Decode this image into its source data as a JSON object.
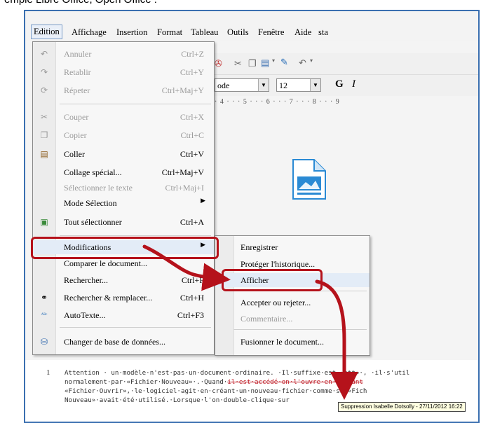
{
  "caption": "emple Libre Office, Open Office :",
  "menubar": {
    "items": [
      "Edition",
      "Affichage",
      "Insertion",
      "Format",
      "Tableau",
      "Outils",
      "Fenêtre",
      "Aide",
      "sta"
    ]
  },
  "toolbar": {
    "style_value": "ode",
    "size_value": "12",
    "bold": "G",
    "italic": "I"
  },
  "ruler": "· 4 · · · 5 · · · 6 · · · 7 · · · 8 · · · 9",
  "edit_menu": {
    "items": [
      {
        "label": "Annuler",
        "shortcut": "Ctrl+Z",
        "disabled": true,
        "icon": "undo-icon"
      },
      {
        "label": "Retablir",
        "shortcut": "Ctrl+Y",
        "disabled": true,
        "icon": "redo-icon"
      },
      {
        "label": "Répeter",
        "shortcut": "Ctrl+Maj+Y",
        "disabled": true,
        "icon": "repeat-icon"
      },
      {
        "label": "Couper",
        "shortcut": "Ctrl+X",
        "disabled": true,
        "icon": "cut-icon"
      },
      {
        "label": "Copier",
        "shortcut": "Ctrl+C",
        "disabled": true,
        "icon": "copy-icon"
      },
      {
        "label": "Coller",
        "shortcut": "Ctrl+V",
        "disabled": false,
        "icon": "paste-icon"
      },
      {
        "label": "Collage spécial...",
        "shortcut": "Ctrl+Maj+V",
        "disabled": false,
        "icon": ""
      },
      {
        "label": "Sélectionner le texte",
        "shortcut": "Ctrl+Maj+I",
        "disabled": true,
        "icon": ""
      },
      {
        "label": "Mode Sélection",
        "shortcut": "",
        "disabled": false,
        "icon": ""
      },
      {
        "label": "Tout sélectionner",
        "shortcut": "Ctrl+A",
        "disabled": false,
        "icon": "select-all-icon"
      },
      {
        "label": "Modifications",
        "shortcut": "",
        "disabled": false,
        "icon": ""
      },
      {
        "label": "Comparer le document...",
        "shortcut": "",
        "disabled": false,
        "icon": ""
      },
      {
        "label": "Rechercher...",
        "shortcut": "Ctrl+F",
        "disabled": false,
        "icon": ""
      },
      {
        "label": "Rechercher & remplacer...",
        "shortcut": "Ctrl+H",
        "disabled": false,
        "icon": "binoculars-icon"
      },
      {
        "label": "AutoTexte...",
        "shortcut": "Ctrl+F3",
        "disabled": false,
        "icon": "autotext-icon"
      },
      {
        "label": "Changer de base de données...",
        "shortcut": "",
        "disabled": false,
        "icon": "database-icon"
      }
    ]
  },
  "submenu": {
    "items": [
      {
        "label": "Enregistrer",
        "disabled": false
      },
      {
        "label": "Protéger l'historique...",
        "disabled": false
      },
      {
        "label": "Afficher",
        "disabled": false,
        "checked": true
      },
      {
        "label": "Accepter ou rejeter...",
        "disabled": false
      },
      {
        "label": "Commentaire...",
        "disabled": true
      },
      {
        "label": "Fusionner le document...",
        "disabled": false
      }
    ]
  },
  "document": {
    "line_number": "1",
    "line1_a": "Attention · un·modèle·n'est·pas·un·document·ordinaire. ·Il·suffixe·est·«ott»·, ·il·s'util",
    "line2_a": "normalement·par·«Fichier·Nouveau»·.·Quand·",
    "line2_red": "il·est·accédé·on·l'ouvre·en·passant",
    "line3_a": "«Fichier·Ouvrir»,·le·logiciel·agit·en·créant·un·nouveau·fichier·comme·si·«Fich",
    "line4_a": "Nouveau»·avait·été·utilisé.·Lorsque·l'on·double-clique·sur",
    "tooltip": "Suppression Isabelle Dotsolly - 27/11/2012 16:22"
  },
  "colors": {
    "highlight": "#b5121b",
    "frame": "#3a6fb0"
  }
}
